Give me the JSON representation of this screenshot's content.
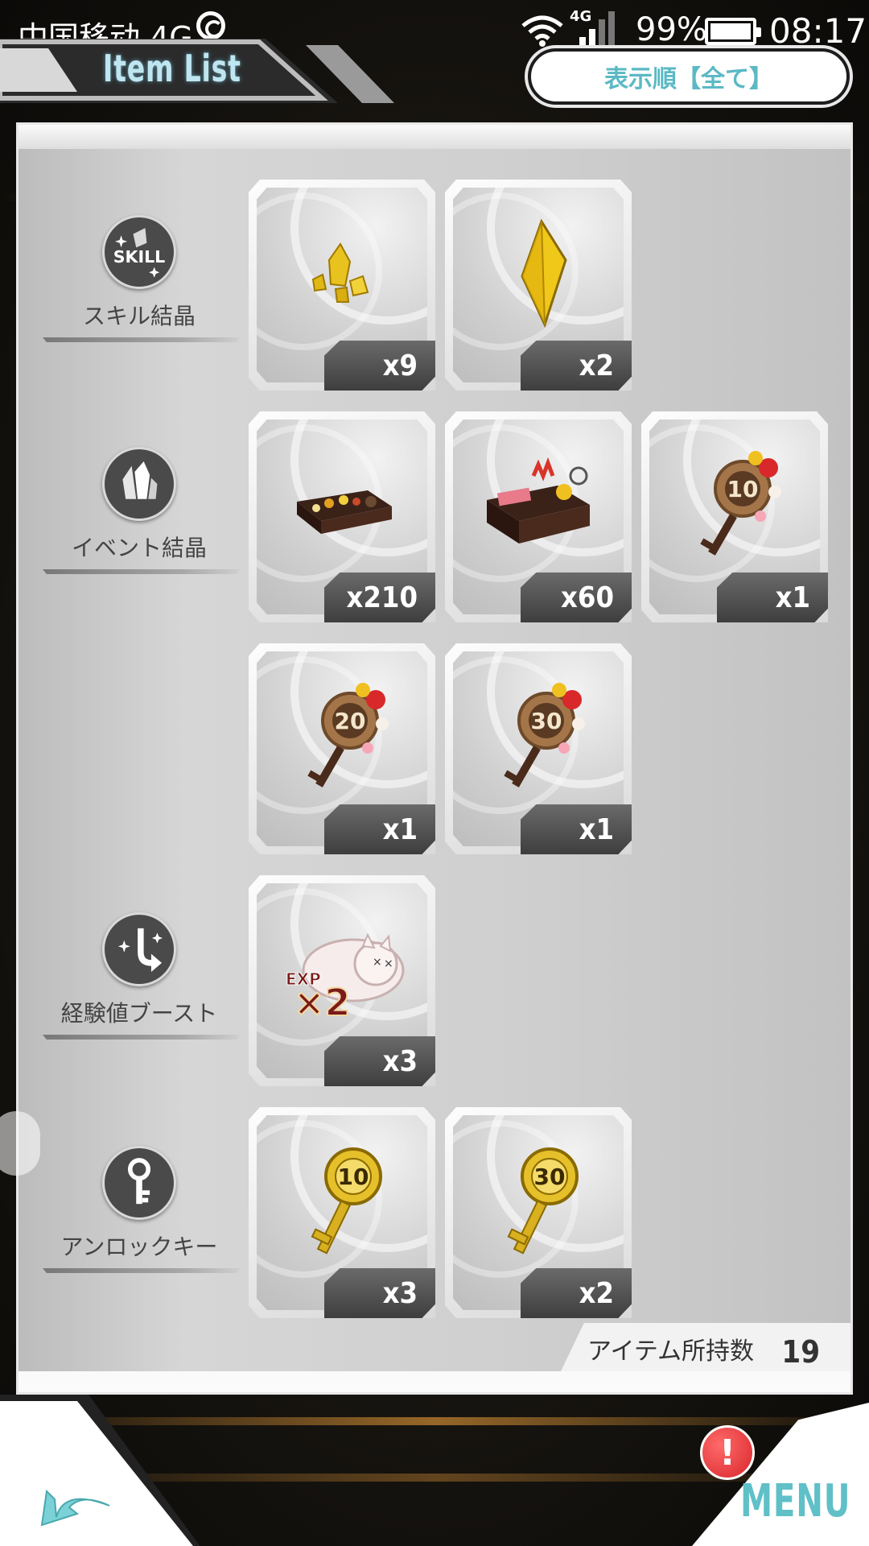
{
  "status_bar": {
    "carrier": "中国移动 4G",
    "network": "4G",
    "battery": "99%",
    "time": "08:17"
  },
  "header": {
    "title": "Item List",
    "sort_label": "表示順【全て】"
  },
  "categories": [
    {
      "label": "スキル結晶",
      "icon": "skill-icon"
    },
    {
      "label": "イベント結晶",
      "icon": "crystal-icon"
    },
    {
      "label": "経験値ブースト",
      "icon": "boost-icon"
    },
    {
      "label": "アンロックキー",
      "icon": "key-icon"
    }
  ],
  "items": [
    {
      "art": "gold-crystal-shards",
      "qty": "x9"
    },
    {
      "art": "gold-crystal-gem",
      "qty": "x2"
    },
    {
      "art": "osechi-box-small",
      "qty": "x210"
    },
    {
      "art": "osechi-box-large",
      "qty": "x60"
    },
    {
      "art": "flower-key",
      "key_number": "10",
      "qty": "x1"
    },
    {
      "art": "flower-key",
      "key_number": "20",
      "qty": "x1"
    },
    {
      "art": "flower-key",
      "key_number": "30",
      "qty": "x1"
    },
    {
      "art": "exp-cat-boost",
      "exp_label": "EXP",
      "exp_mult": "×2",
      "qty": "x3"
    },
    {
      "art": "gold-key",
      "key_number": "10",
      "qty": "x3"
    },
    {
      "art": "gold-key",
      "key_number": "30",
      "qty": "x2"
    }
  ],
  "footer": {
    "label": "アイテム所持数",
    "count": "19"
  },
  "nav": {
    "menu_label": "MENU",
    "alert": "!"
  },
  "colors": {
    "accent": "#5fc0c8",
    "alert": "#d8262b",
    "gold": "#e6c02a"
  }
}
